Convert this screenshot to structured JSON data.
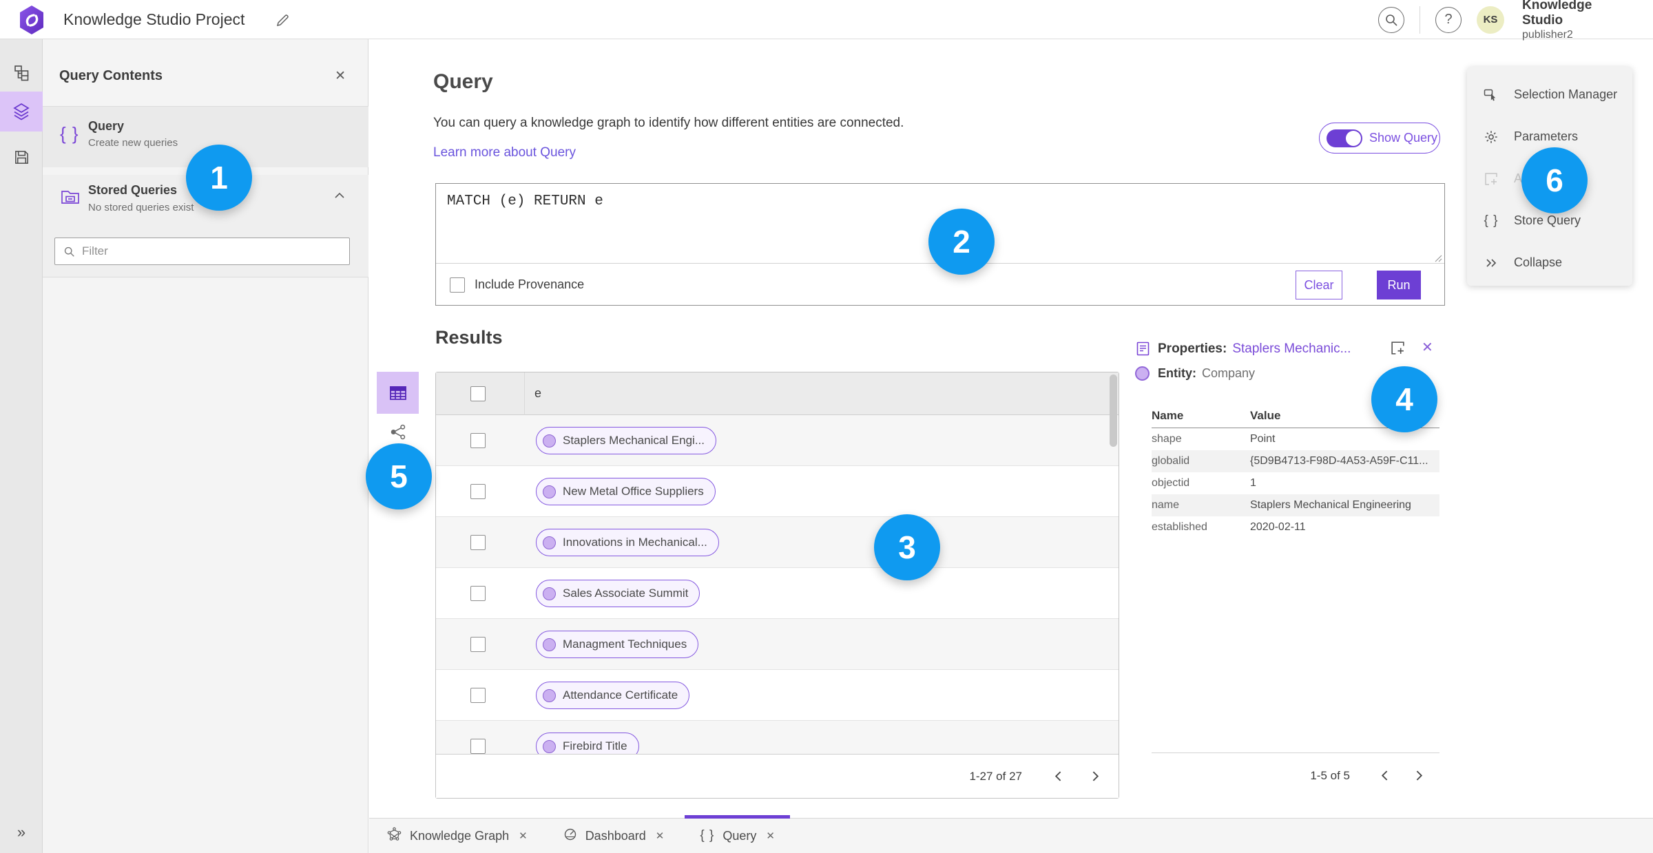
{
  "colors": {
    "accent_purple": "#6d3fd4",
    "annotation_blue": "#0f9af0"
  },
  "header": {
    "app_title": "Knowledge Studio Project",
    "user_name": "Knowledge Studio",
    "user_role": "publisher2",
    "avatar_initials": "KS"
  },
  "left_panel": {
    "title": "Query Contents",
    "query_item": {
      "title": "Query",
      "subtitle": "Create new queries"
    },
    "stored_item": {
      "title": "Stored Queries",
      "subtitle": "No stored queries exist"
    },
    "filter_placeholder": "Filter"
  },
  "query": {
    "heading": "Query",
    "description": "You can query a knowledge graph to identify how different entities are connected.",
    "learn_more": "Learn more about Query",
    "show_query": "Show Query",
    "editor_text": "MATCH (e) RETURN e",
    "include_provenance": "Include Provenance",
    "clear": "Clear",
    "run": "Run"
  },
  "results": {
    "heading": "Results",
    "column": "e",
    "rows": [
      "Staplers Mechanical Engi...",
      "New Metal Office Suppliers",
      "Innovations in Mechanical...",
      "Sales Associate Summit",
      "Managment Techniques",
      "Attendance Certificate",
      "Firebird Title"
    ],
    "page_label": "1-27 of 27"
  },
  "properties": {
    "label": "Properties:",
    "entity_link": "Staplers Mechanic...",
    "entity_label": "Entity:",
    "entity_type": "Company",
    "col_name": "Name",
    "col_value": "Value",
    "rows": [
      {
        "name": "shape",
        "value": "Point"
      },
      {
        "name": "globalid",
        "value": "{5D9B4713-F98D-4A53-A59F-C11..."
      },
      {
        "name": "objectid",
        "value": "1"
      },
      {
        "name": "name",
        "value": "Staplers Mechanical Engineering"
      },
      {
        "name": "established",
        "value": "2020-02-11"
      }
    ],
    "page_label": "1-5 of 5"
  },
  "tools_menu": {
    "items": [
      {
        "label": "Selection Manager",
        "icon": "selection-manager-icon",
        "disabled": false
      },
      {
        "label": "Parameters",
        "icon": "gear-icon",
        "disabled": false
      },
      {
        "label": "Add",
        "icon": "add-to-map-icon",
        "disabled": true
      },
      {
        "label": "Store Query",
        "icon": "braces-icon",
        "disabled": false
      },
      {
        "label": "Collapse",
        "icon": "double-chevron-right-icon",
        "disabled": false
      }
    ]
  },
  "bottom_tabs": [
    {
      "label": "Knowledge Graph",
      "icon": "knowledge-graph-icon",
      "active": false
    },
    {
      "label": "Dashboard",
      "icon": "dashboard-icon",
      "active": false
    },
    {
      "label": "Query",
      "icon": "braces-icon",
      "active": true
    }
  ],
  "annotations": [
    "1",
    "2",
    "3",
    "4",
    "5",
    "6"
  ]
}
